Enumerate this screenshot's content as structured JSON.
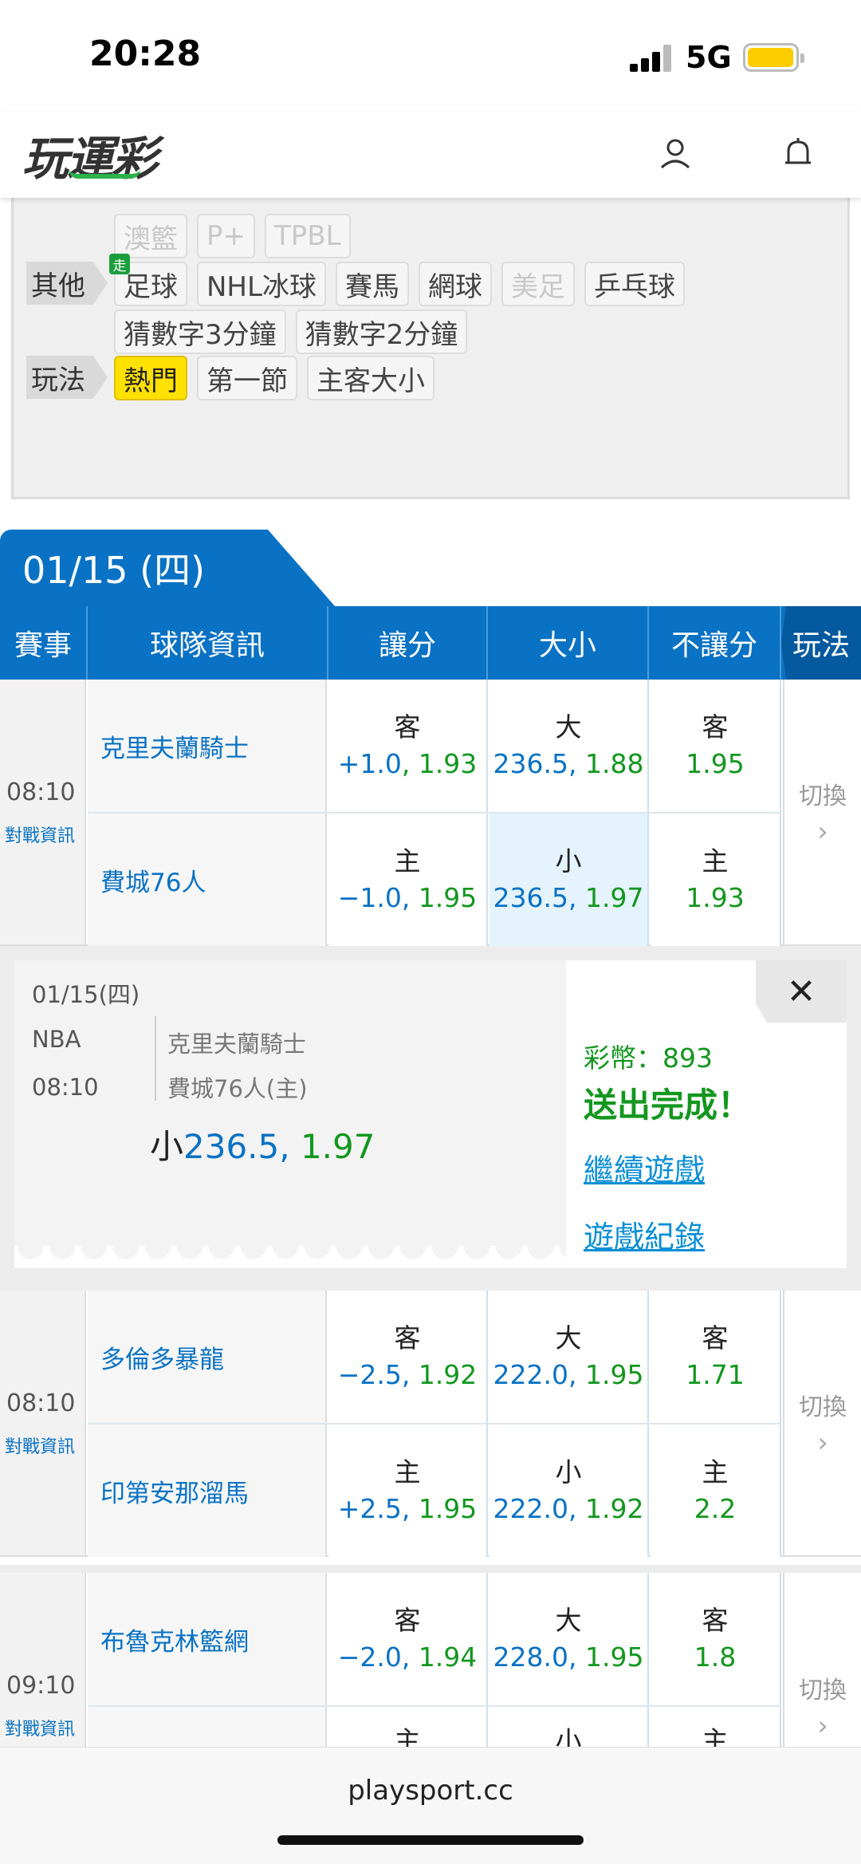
{
  "status": {
    "time": "20:28",
    "network": "5G"
  },
  "header": {
    "logo": "玩運彩"
  },
  "filters": {
    "top_row": [
      "澳籃",
      "P+",
      "TPBL"
    ],
    "other_label": "其他",
    "other_items": [
      "足球",
      "NHL冰球",
      "賽馬",
      "網球",
      "美足",
      "乒乓球"
    ],
    "walk_badge": "走",
    "guess_items": [
      "猜數字3分鐘",
      "猜數字2分鐘"
    ],
    "play_label": "玩法",
    "play_items": [
      "熱門",
      "第一節",
      "主客大小"
    ]
  },
  "date_tab": "01/15 (四)",
  "table_head": {
    "event": "賽事",
    "team_info": "球隊資訊",
    "spread": "讓分",
    "total": "大小",
    "moneyline": "不讓分",
    "play": "玩法"
  },
  "matches": [
    {
      "time": "08:10",
      "info_link": "對戰資訊",
      "switch": "切換",
      "away": {
        "team": "克里夫蘭騎士",
        "spread_side": "客",
        "spread_line": "+1.0",
        "spread_price": "1.93",
        "total_side": "大",
        "total_line": "236.5",
        "total_price": "1.88",
        "ml_side": "客",
        "ml_price": "1.95"
      },
      "home": {
        "team": "費城76人",
        "spread_side": "主",
        "spread_line": "−1.0",
        "spread_price": "1.95",
        "total_side": "小",
        "total_line": "236.5",
        "total_price": "1.97",
        "ml_side": "主",
        "ml_price": "1.93"
      }
    },
    {
      "time": "08:10",
      "info_link": "對戰資訊",
      "switch": "切換",
      "away": {
        "team": "多倫多暴龍",
        "spread_side": "客",
        "spread_line": "−2.5",
        "spread_price": "1.92",
        "total_side": "大",
        "total_line": "222.0",
        "total_price": "1.95",
        "ml_side": "客",
        "ml_price": "1.71"
      },
      "home": {
        "team": "印第安那溜馬",
        "spread_side": "主",
        "spread_line": "+2.5",
        "spread_price": "1.95",
        "total_side": "小",
        "total_line": "222.0",
        "total_price": "1.92",
        "ml_side": "主",
        "ml_price": "2.2"
      }
    },
    {
      "time": "09:10",
      "info_link": "對戰資訊",
      "switch": "切換",
      "away": {
        "team": "布魯克林籃網",
        "spread_side": "客",
        "spread_line": "−2.0",
        "spread_price": "1.94",
        "total_side": "大",
        "total_line": "228.0",
        "total_price": "1.95",
        "ml_side": "客",
        "ml_price": "1.8"
      },
      "home": {
        "team": "",
        "spread_side": "主",
        "spread_line": "",
        "spread_price": "",
        "total_side": "小",
        "total_line": "",
        "total_price": "",
        "ml_side": "主",
        "ml_price": ""
      }
    }
  ],
  "confirm": {
    "date": "01/15(四)",
    "league": "NBA",
    "time": "08:10",
    "away": "克里夫蘭騎士",
    "home": "費城76人(主)",
    "pick_label": "小",
    "pick_line": "236.5,",
    "pick_price": " 1.97",
    "coins": "彩幣：893",
    "sent": "送出完成！",
    "continue": "繼續遊戲",
    "history": "遊戲紀錄",
    "close": "✕"
  },
  "footer": {
    "url": "playsport.cc"
  },
  "colors": {
    "primary": "#0a72c4",
    "odds_green": "#13971f",
    "active_chip": "#ffe100",
    "selected_cell": "#e4f3fc"
  }
}
